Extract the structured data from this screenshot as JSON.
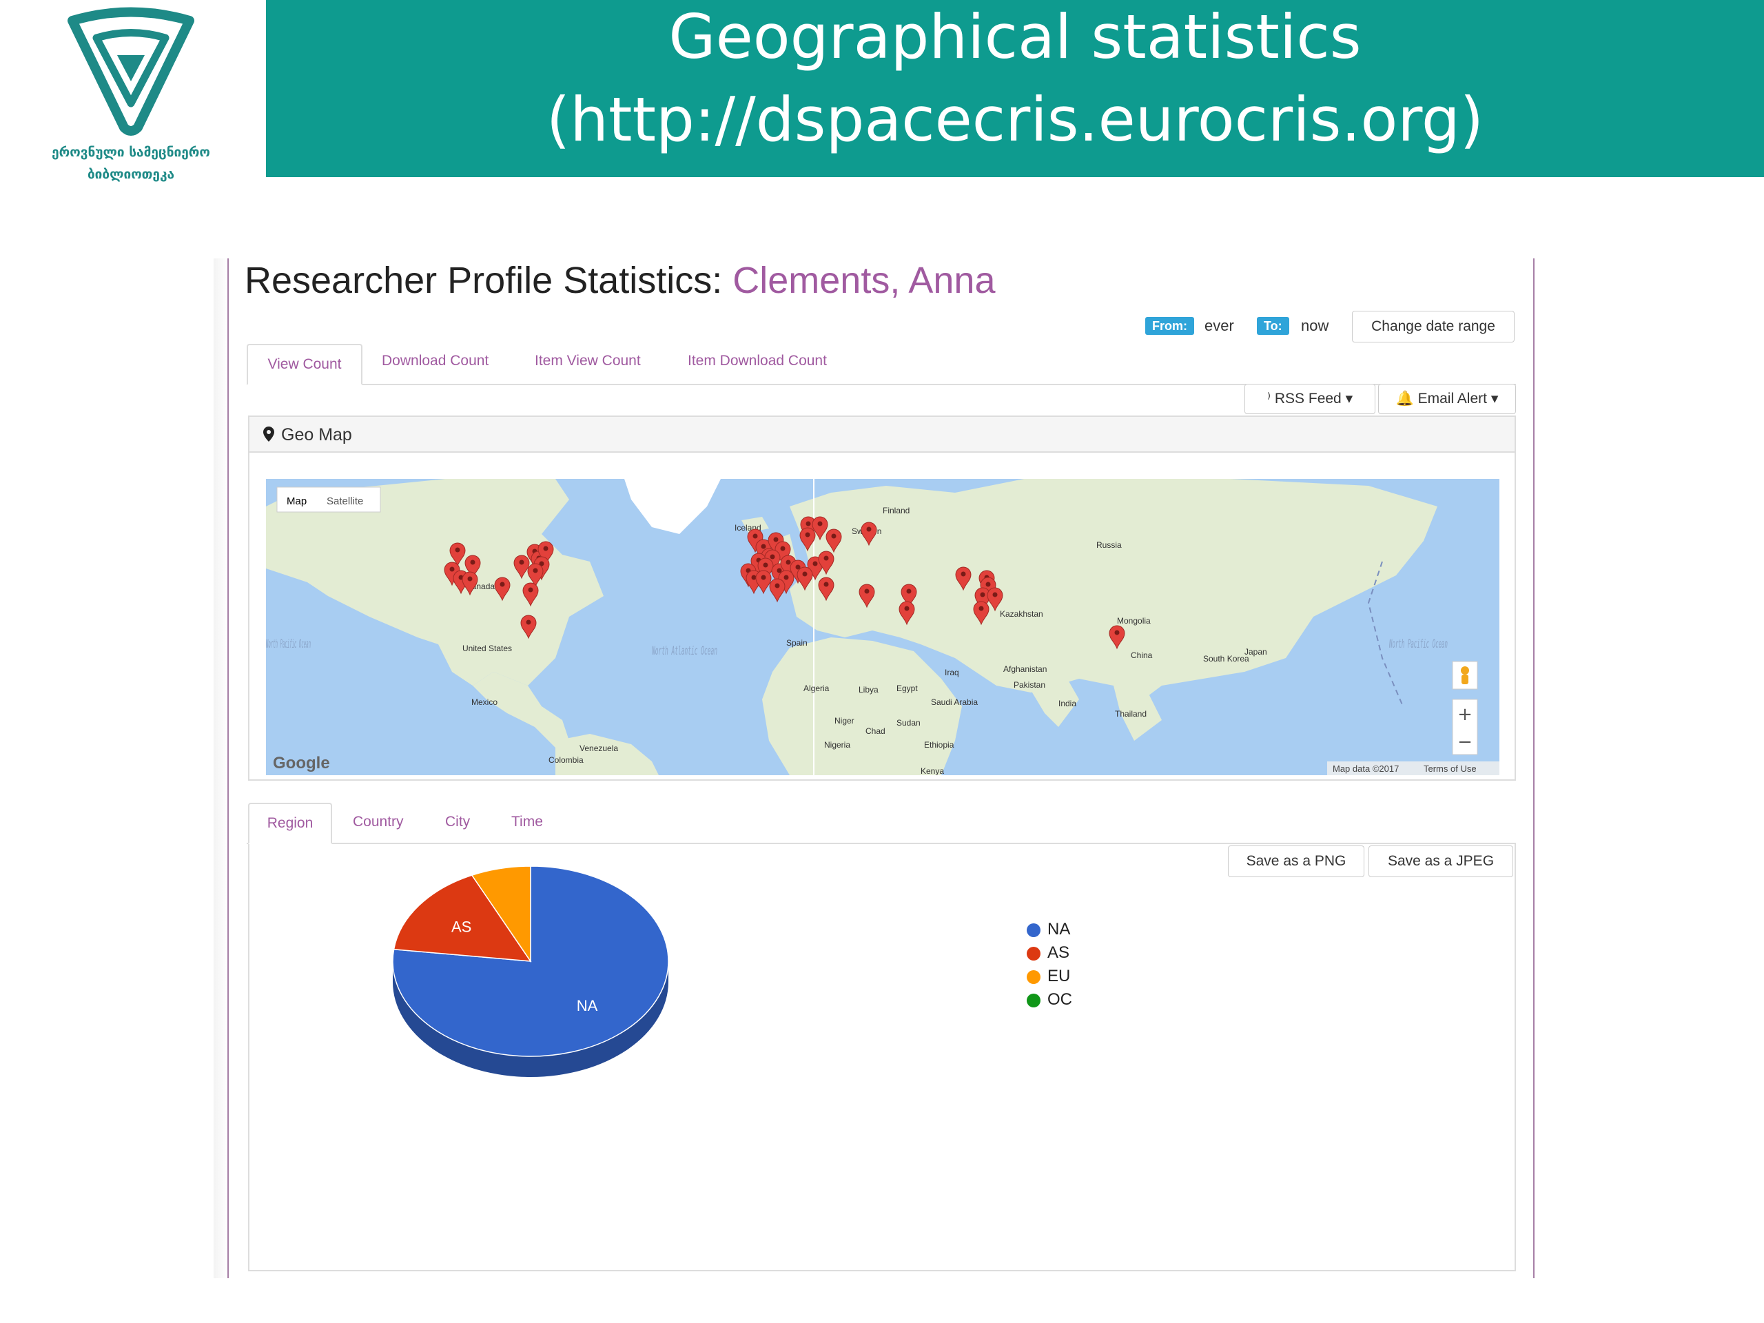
{
  "logo": {
    "line1": "ეროვნული სამეცნიერო",
    "line2": "ბიბლიოთეკა"
  },
  "banner": {
    "title": "Geographical statistics",
    "url": "(http://dspacecris.eurocris.org)"
  },
  "profile": {
    "heading_prefix": "Researcher Profile Statistics:",
    "name": "Clements, Anna"
  },
  "date_range": {
    "from_label": "From:",
    "from_value": "ever",
    "to_label": "To:",
    "to_value": "now",
    "change_button": "Change date range"
  },
  "main_tabs": [
    "View Count",
    "Download Count",
    "Item View Count",
    "Item Download Count"
  ],
  "toolbar": {
    "rss": "RSS Feed",
    "email": "Email Alert"
  },
  "geo": {
    "title": "Geo Map",
    "map_type": [
      "Map",
      "Satellite"
    ],
    "labels": {
      "canada": "Canada",
      "united_states": "United States",
      "mexico": "Mexico",
      "venezuela": "Venezuela",
      "colombia": "Colombia",
      "north_pacific_left": "North Pacific Ocean",
      "north_atlantic": "North Atlantic Ocean",
      "iceland": "Iceland",
      "finland": "Finland",
      "sweden": "Sweden",
      "russia": "Russia",
      "kazakhstan": "Kazakhstan",
      "mongolia": "Mongolia",
      "china": "China",
      "south_korea": "South Korea",
      "japan": "Japan",
      "north_pacific_right": "North Pacific Ocean",
      "afghanistan": "Afghanistan",
      "pakistan": "Pakistan",
      "india": "India",
      "thailand": "Thailand",
      "iraq": "Iraq",
      "saudi_arabia": "Saudi Arabia",
      "algeria": "Algeria",
      "libya": "Libya",
      "egypt": "Egypt",
      "niger": "Niger",
      "chad": "Chad",
      "sudan": "Sudan",
      "nigeria": "Nigeria",
      "ethiopia": "Ethiopia",
      "kenya": "Kenya",
      "spain": "Spain"
    },
    "attribution": "Map data ©2017",
    "terms": "Terms of Use",
    "google": "Google",
    "zoom_in": "+",
    "zoom_out": "−"
  },
  "sub_tabs": [
    "Region",
    "Country",
    "City",
    "Time"
  ],
  "save": {
    "png": "Save as a PNG",
    "jpeg": "Save as a JPEG"
  },
  "chart_data": {
    "type": "pie",
    "categories": [
      "NA",
      "AS",
      "EU",
      "OC"
    ],
    "values": [
      77,
      16,
      7,
      0
    ],
    "colors": [
      "#3366cc",
      "#dc3912",
      "#ff9900",
      "#109618"
    ],
    "slice_labels": [
      "NA",
      "AS",
      "",
      ""
    ],
    "legend_position": "right",
    "three_d": true
  }
}
